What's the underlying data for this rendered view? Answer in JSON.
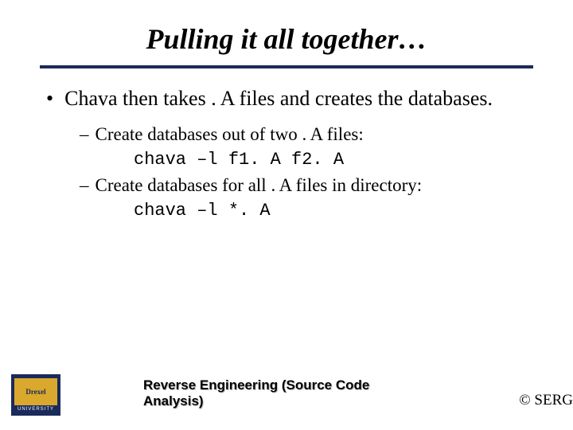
{
  "title": "Pulling it all together…",
  "bullet": {
    "text": "Chava then takes . A files and creates the databases."
  },
  "sub": [
    {
      "text": "Create databases out of two . A files:",
      "code": "chava –l f1. A f2. A"
    },
    {
      "text": "Create databases for all . A files in directory:",
      "code": "chava –l *. A"
    }
  ],
  "footer": {
    "title": "Reverse Engineering (Source Code Analysis)",
    "copyright": "© SERG",
    "logo_name": "Drexel",
    "logo_sub": "UNIVERSITY"
  }
}
